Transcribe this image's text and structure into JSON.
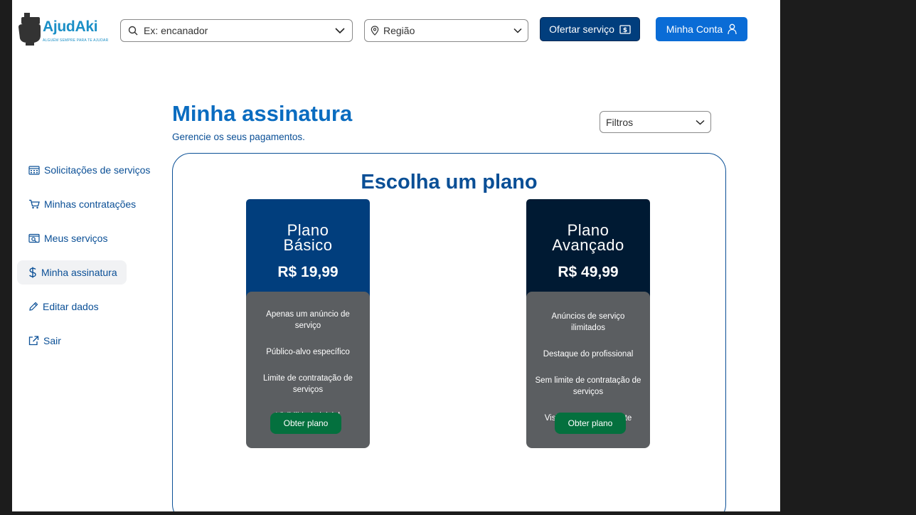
{
  "brand": {
    "name": "AjudAki",
    "tagline": "ALGUÉM SEMPRE PARA TE AJUDAR",
    "color": "#1b8fc6"
  },
  "header": {
    "search_placeholder": "Ex: encanador",
    "region_placeholder": "Região",
    "offer_button": "Ofertar serviço",
    "account_button": "Minha Conta"
  },
  "page": {
    "title": "Minha assinatura",
    "subtitle": "Gerencie os seus pagamentos.",
    "filter_label": "Filtros"
  },
  "sidebar": {
    "items": [
      {
        "label": "Solicitações de serviços",
        "icon": "calendar-icon"
      },
      {
        "label": "Minhas contratações",
        "icon": "cart-icon"
      },
      {
        "label": "Meus serviços",
        "icon": "search-window-icon"
      },
      {
        "label": "Minha assinatura",
        "icon": "dollar-icon",
        "active": true
      },
      {
        "label": "Editar dados",
        "icon": "pencil-icon"
      },
      {
        "label": "Sair",
        "icon": "external-link-icon"
      }
    ]
  },
  "plans_section": {
    "title": "Escolha um plano",
    "plans": [
      {
        "name_line1": "Plano",
        "name_line2": "Básico",
        "price": "R$ 19,99",
        "color": "#013e7d",
        "features": [
          "Apenas um anúncio de serviço",
          "Público-alvo específico",
          "Limite de contratação de serviços",
          "Visibilidade inicial"
        ],
        "button": "Obter plano"
      },
      {
        "name_line1": "Plano",
        "name_line2": "Avançado",
        "price": "R$ 49,99",
        "color": "#001a33",
        "features": [
          "Anúncios de serviço ilimitados",
          "Destaque do profissional",
          "Sem limite de contratação de serviços",
          "Visibilidade permanente"
        ],
        "button": "Obter plano"
      }
    ]
  },
  "colors": {
    "primary": "#0a6cd6",
    "dark_blue": "#013e7d",
    "green": "#04703e",
    "text_blue": "#0a4f96"
  }
}
